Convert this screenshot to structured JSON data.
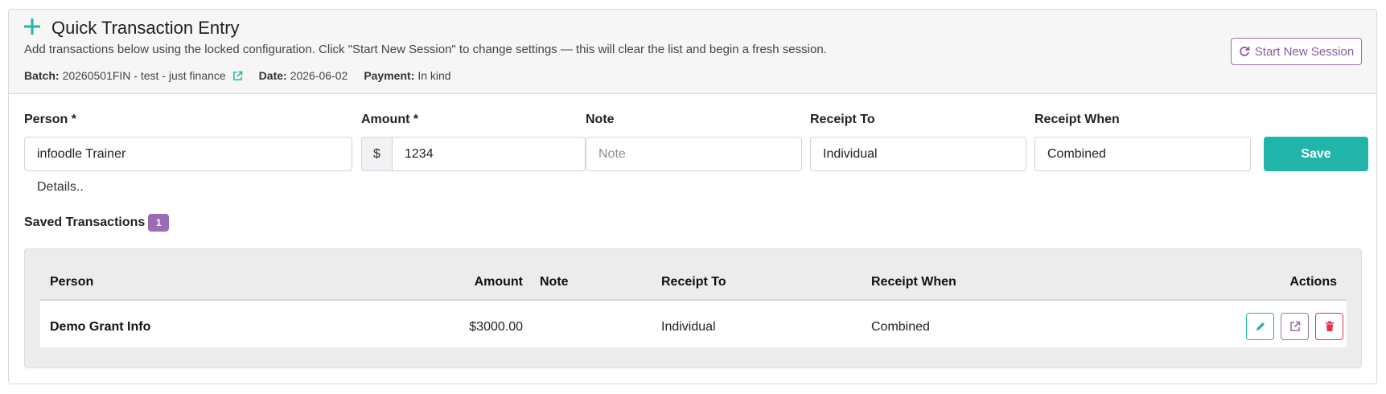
{
  "header": {
    "title": "Quick Transaction Entry",
    "subtitle": "Add transactions below using the locked configuration. Click \"Start New Session\" to change settings — this will clear the list and begin a fresh session.",
    "batch_label": "Batch:",
    "batch_value": "20260501FIN - test - just finance",
    "date_label": "Date:",
    "date_value": "2026-06-02",
    "payment_label": "Payment:",
    "payment_value": "In kind",
    "start_session_label": "Start New Session"
  },
  "form": {
    "person_label": "Person *",
    "person_value": "infoodle Trainer",
    "amount_label": "Amount *",
    "currency_symbol": "$",
    "amount_value": "1234",
    "note_label": "Note",
    "note_placeholder": "Note",
    "note_value": "",
    "receipt_to_label": "Receipt To",
    "receipt_to_value": "Individual",
    "receipt_when_label": "Receipt When",
    "receipt_when_value": "Combined",
    "save_label": "Save",
    "details_label": "Details.."
  },
  "saved": {
    "title": "Saved Transactions",
    "count": "1",
    "columns": {
      "person": "Person",
      "amount": "Amount",
      "note": "Note",
      "receipt_to": "Receipt To",
      "receipt_when": "Receipt When",
      "actions": "Actions"
    },
    "rows": [
      {
        "person": "Demo Grant Info",
        "amount": "$3000.00",
        "note": "",
        "receipt_to": "Individual",
        "receipt_when": "Combined"
      }
    ]
  },
  "icons": {
    "add": "plus-icon",
    "batch_link": "external-link-icon",
    "refresh": "refresh-icon",
    "edit": "pencil-icon",
    "open": "external-link-icon",
    "delete": "trash-icon"
  },
  "colors": {
    "accent": "#20b5a8",
    "purple": "#9b6bb3",
    "danger": "#e0314b"
  }
}
